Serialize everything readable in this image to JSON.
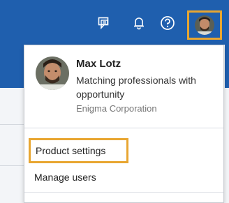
{
  "topbar": {
    "icons": [
      "chat-icon",
      "bell-icon",
      "help-icon"
    ],
    "accent": "#1f5fae"
  },
  "profile": {
    "name": "Max Lotz",
    "tagline": "Matching professionals with opportunity",
    "company": "Enigma Corporation"
  },
  "menu": {
    "items": [
      {
        "label": "Product settings",
        "highlighted": true
      },
      {
        "label": "Manage users",
        "highlighted": false
      }
    ]
  },
  "highlight_color": "#e8a631"
}
